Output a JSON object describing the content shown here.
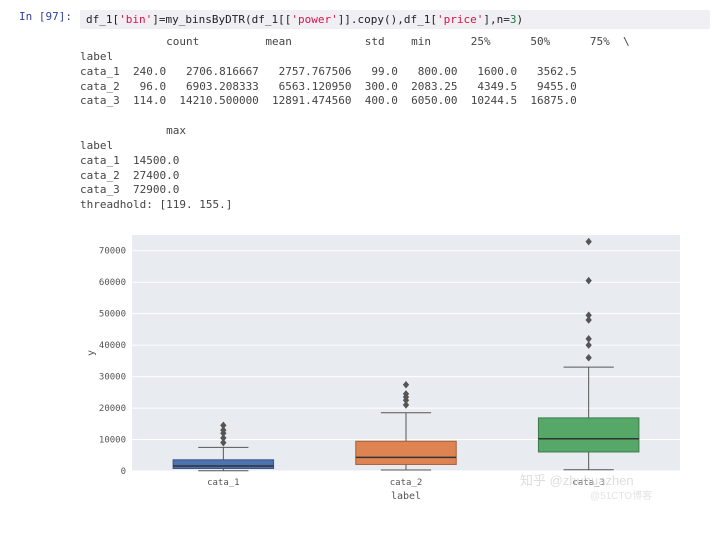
{
  "prompt": "In [97]:",
  "code_parts": {
    "p0": "df_1[",
    "p1": "'bin'",
    "p2": "]=my_binsByDTR(df_1[[",
    "p3": "'power'",
    "p4": "]].copy(),df_1[",
    "p5": "'price'",
    "p6": "],n=",
    "p7": "3",
    "p8": ")"
  },
  "out1": "             count          mean           std    min      25%      50%      75%  \\\nlabel\ncata_1  240.0   2706.816667   2757.767506   99.0   800.00   1600.0   3562.5\ncata_2   96.0   6903.208333   6563.120950  300.0  2083.25   4349.5   9455.0\ncata_3  114.0  14210.500000  12891.474560  400.0  6050.00  10244.5  16875.0\n\n             max\nlabel\ncata_1  14500.0\ncata_2  27400.0\ncata_3  72900.0\nthreadhold: [119. 155.]",
  "chart_data": {
    "type": "box",
    "xlabel": "label",
    "ylabel": "y",
    "categories": [
      "cata_1",
      "cata_2",
      "cata_3"
    ],
    "ylim": [
      0,
      75000
    ],
    "yticks": [
      0,
      10000,
      20000,
      30000,
      40000,
      50000,
      60000,
      70000
    ],
    "series": [
      {
        "name": "cata_1",
        "q1": 800,
        "median": 1600,
        "q3": 3562.5,
        "whisker_low": 99,
        "whisker_high": 7500,
        "outliers": [
          9000,
          10500,
          12000,
          13000,
          14500
        ]
      },
      {
        "name": "cata_2",
        "q1": 2083.25,
        "median": 4349.5,
        "q3": 9455,
        "whisker_low": 300,
        "whisker_high": 18500,
        "outliers": [
          21000,
          22500,
          23500,
          24500,
          27400
        ]
      },
      {
        "name": "cata_3",
        "q1": 6050,
        "median": 10244.5,
        "q3": 16875,
        "whisker_low": 400,
        "whisker_high": 33000,
        "outliers": [
          36000,
          40000,
          42000,
          48000,
          49500,
          60500,
          72900
        ]
      }
    ]
  },
  "watermark1": "知乎 @zhuhuazhen",
  "watermark2": "@51CTO博客"
}
